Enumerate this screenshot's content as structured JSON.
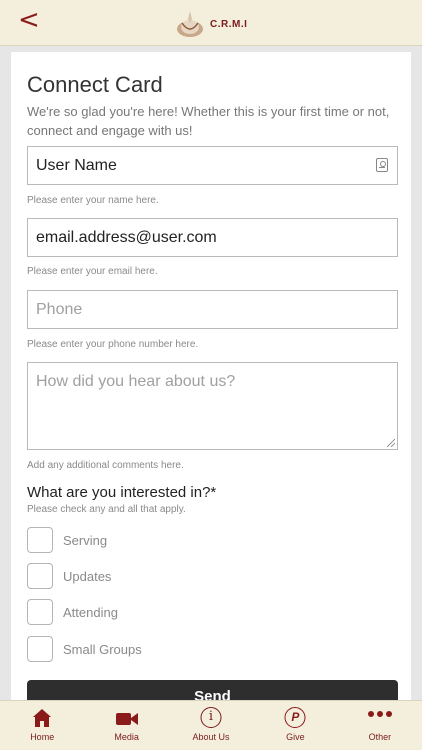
{
  "header": {
    "back_glyph": "<",
    "logo_text": "C.R.M.I"
  },
  "form": {
    "title": "Connect Card",
    "subtitle": "We're so glad you're here! Whether this is your first time or not, connect and engage with us!",
    "name_value": "User Name",
    "name_hint": "Please enter your name here.",
    "email_value": "email.address@user.com",
    "email_hint": "Please enter your email here.",
    "phone_placeholder": "Phone",
    "phone_hint": "Please enter your phone number here.",
    "comments_placeholder": "How did you hear about us?",
    "comments_hint": "Add any additional comments here.",
    "interests_question": "What are you interested in?*",
    "interests_hint": "Please check any and all that apply.",
    "interests": [
      "Serving",
      "Updates",
      "Attending",
      "Small Groups"
    ],
    "send_label": "Send"
  },
  "tabs": [
    {
      "label": "Home",
      "icon": "home-icon"
    },
    {
      "label": "Media",
      "icon": "video-camera-icon"
    },
    {
      "label": "About Us",
      "icon": "info-icon"
    },
    {
      "label": "Give",
      "icon": "give-icon"
    },
    {
      "label": "Other",
      "icon": "more-dots-icon"
    }
  ],
  "colors": {
    "brand": "#8b1a1a",
    "header_bg": "#f3efdc",
    "button_bg": "#2e2e2e"
  }
}
